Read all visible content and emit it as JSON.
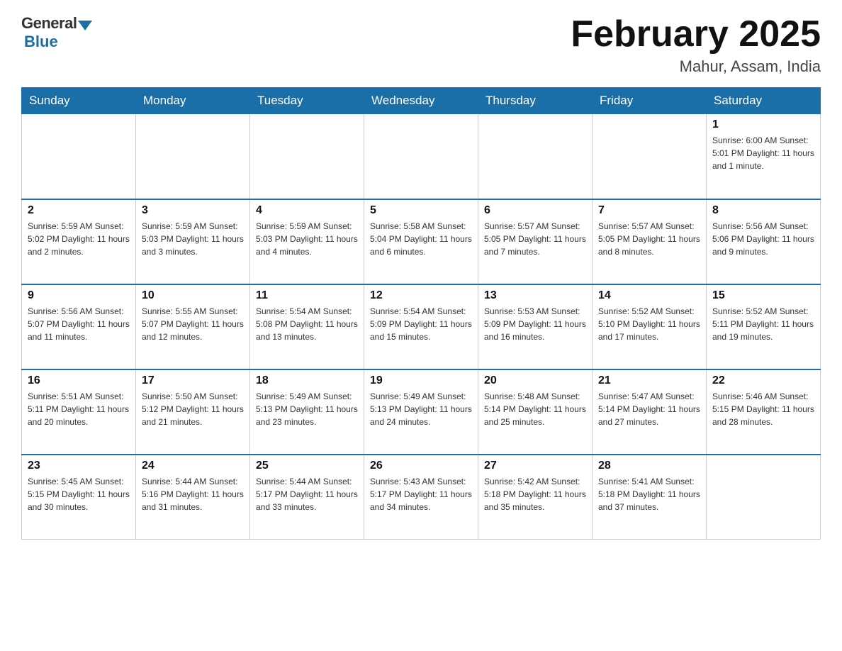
{
  "header": {
    "logo_general": "General",
    "logo_blue": "Blue",
    "month_title": "February 2025",
    "location": "Mahur, Assam, India"
  },
  "weekdays": [
    "Sunday",
    "Monday",
    "Tuesday",
    "Wednesday",
    "Thursday",
    "Friday",
    "Saturday"
  ],
  "weeks": [
    [
      {
        "day": "",
        "info": ""
      },
      {
        "day": "",
        "info": ""
      },
      {
        "day": "",
        "info": ""
      },
      {
        "day": "",
        "info": ""
      },
      {
        "day": "",
        "info": ""
      },
      {
        "day": "",
        "info": ""
      },
      {
        "day": "1",
        "info": "Sunrise: 6:00 AM\nSunset: 5:01 PM\nDaylight: 11 hours\nand 1 minute."
      }
    ],
    [
      {
        "day": "2",
        "info": "Sunrise: 5:59 AM\nSunset: 5:02 PM\nDaylight: 11 hours\nand 2 minutes."
      },
      {
        "day": "3",
        "info": "Sunrise: 5:59 AM\nSunset: 5:03 PM\nDaylight: 11 hours\nand 3 minutes."
      },
      {
        "day": "4",
        "info": "Sunrise: 5:59 AM\nSunset: 5:03 PM\nDaylight: 11 hours\nand 4 minutes."
      },
      {
        "day": "5",
        "info": "Sunrise: 5:58 AM\nSunset: 5:04 PM\nDaylight: 11 hours\nand 6 minutes."
      },
      {
        "day": "6",
        "info": "Sunrise: 5:57 AM\nSunset: 5:05 PM\nDaylight: 11 hours\nand 7 minutes."
      },
      {
        "day": "7",
        "info": "Sunrise: 5:57 AM\nSunset: 5:05 PM\nDaylight: 11 hours\nand 8 minutes."
      },
      {
        "day": "8",
        "info": "Sunrise: 5:56 AM\nSunset: 5:06 PM\nDaylight: 11 hours\nand 9 minutes."
      }
    ],
    [
      {
        "day": "9",
        "info": "Sunrise: 5:56 AM\nSunset: 5:07 PM\nDaylight: 11 hours\nand 11 minutes."
      },
      {
        "day": "10",
        "info": "Sunrise: 5:55 AM\nSunset: 5:07 PM\nDaylight: 11 hours\nand 12 minutes."
      },
      {
        "day": "11",
        "info": "Sunrise: 5:54 AM\nSunset: 5:08 PM\nDaylight: 11 hours\nand 13 minutes."
      },
      {
        "day": "12",
        "info": "Sunrise: 5:54 AM\nSunset: 5:09 PM\nDaylight: 11 hours\nand 15 minutes."
      },
      {
        "day": "13",
        "info": "Sunrise: 5:53 AM\nSunset: 5:09 PM\nDaylight: 11 hours\nand 16 minutes."
      },
      {
        "day": "14",
        "info": "Sunrise: 5:52 AM\nSunset: 5:10 PM\nDaylight: 11 hours\nand 17 minutes."
      },
      {
        "day": "15",
        "info": "Sunrise: 5:52 AM\nSunset: 5:11 PM\nDaylight: 11 hours\nand 19 minutes."
      }
    ],
    [
      {
        "day": "16",
        "info": "Sunrise: 5:51 AM\nSunset: 5:11 PM\nDaylight: 11 hours\nand 20 minutes."
      },
      {
        "day": "17",
        "info": "Sunrise: 5:50 AM\nSunset: 5:12 PM\nDaylight: 11 hours\nand 21 minutes."
      },
      {
        "day": "18",
        "info": "Sunrise: 5:49 AM\nSunset: 5:13 PM\nDaylight: 11 hours\nand 23 minutes."
      },
      {
        "day": "19",
        "info": "Sunrise: 5:49 AM\nSunset: 5:13 PM\nDaylight: 11 hours\nand 24 minutes."
      },
      {
        "day": "20",
        "info": "Sunrise: 5:48 AM\nSunset: 5:14 PM\nDaylight: 11 hours\nand 25 minutes."
      },
      {
        "day": "21",
        "info": "Sunrise: 5:47 AM\nSunset: 5:14 PM\nDaylight: 11 hours\nand 27 minutes."
      },
      {
        "day": "22",
        "info": "Sunrise: 5:46 AM\nSunset: 5:15 PM\nDaylight: 11 hours\nand 28 minutes."
      }
    ],
    [
      {
        "day": "23",
        "info": "Sunrise: 5:45 AM\nSunset: 5:15 PM\nDaylight: 11 hours\nand 30 minutes."
      },
      {
        "day": "24",
        "info": "Sunrise: 5:44 AM\nSunset: 5:16 PM\nDaylight: 11 hours\nand 31 minutes."
      },
      {
        "day": "25",
        "info": "Sunrise: 5:44 AM\nSunset: 5:17 PM\nDaylight: 11 hours\nand 33 minutes."
      },
      {
        "day": "26",
        "info": "Sunrise: 5:43 AM\nSunset: 5:17 PM\nDaylight: 11 hours\nand 34 minutes."
      },
      {
        "day": "27",
        "info": "Sunrise: 5:42 AM\nSunset: 5:18 PM\nDaylight: 11 hours\nand 35 minutes."
      },
      {
        "day": "28",
        "info": "Sunrise: 5:41 AM\nSunset: 5:18 PM\nDaylight: 11 hours\nand 37 minutes."
      },
      {
        "day": "",
        "info": ""
      }
    ]
  ]
}
